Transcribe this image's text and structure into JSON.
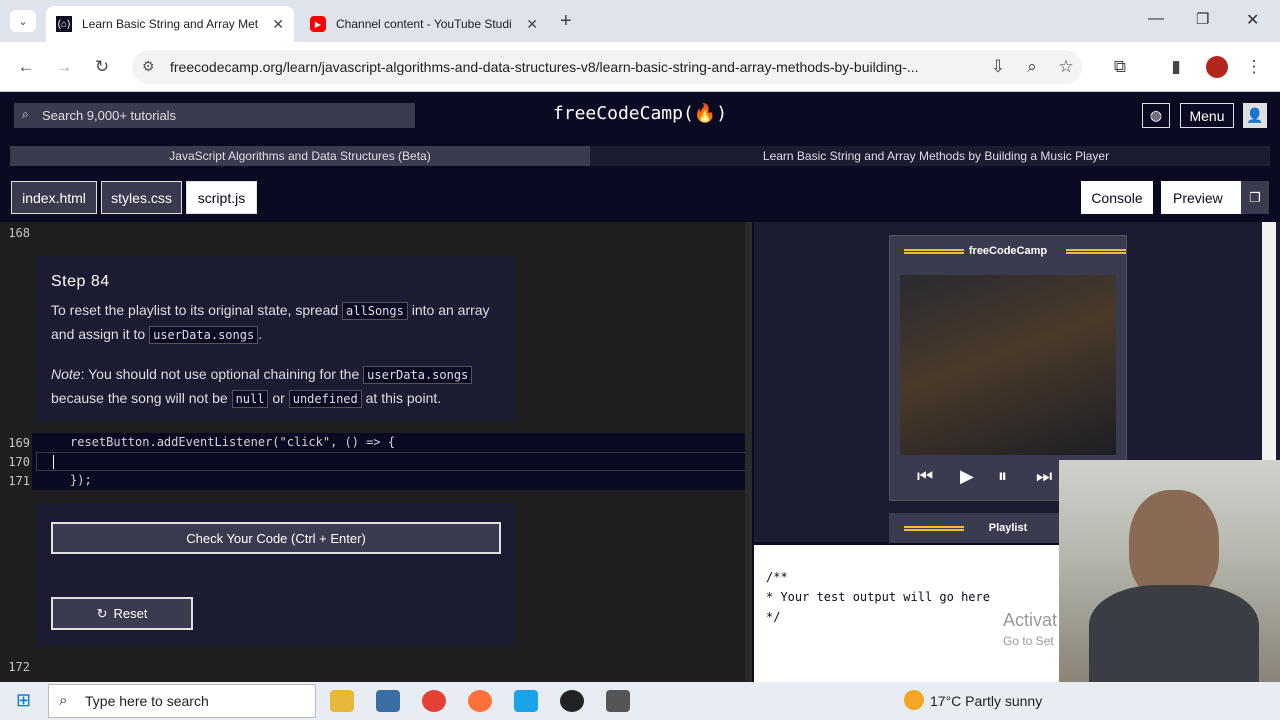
{
  "browser": {
    "tabs": [
      {
        "title": "Learn Basic String and Array Met",
        "active": true
      },
      {
        "title": "Channel content - YouTube Studi",
        "active": false
      }
    ],
    "url": "freecodecamp.org/learn/javascript-algorithms-and-data-structures-v8/learn-basic-string-and-array-methods-by-building-..."
  },
  "nav": {
    "search_placeholder": "Search 9,000+ tutorials",
    "logo": "freeCodeCamp(🔥)",
    "menu_label": "Menu"
  },
  "breadcrumb": {
    "course": "JavaScript Algorithms and Data Structures (Beta)",
    "project": "Learn Basic String and Array Methods by Building a Music Player"
  },
  "files": [
    "index.html",
    "styles.css",
    "script.js"
  ],
  "active_file": "script.js",
  "right_buttons": {
    "console": "Console",
    "preview": "Preview"
  },
  "editor": {
    "line_168": "168",
    "line_172": "172",
    "step": {
      "title": "Step 84",
      "p1_a": "To reset the playlist to its original state, spread",
      "p1_code1": "allSongs",
      "p1_b": "into an array and assign it to",
      "p1_code2": "userData.songs",
      "p1_c": ".",
      "note_label": "Note",
      "p2_a": ": You should not use optional chaining for the",
      "p2_code1": "userData.songs",
      "p2_b": "because the song will not be",
      "p2_code2": "null",
      "p2_c": "or",
      "p2_code3": "undefined",
      "p2_d": "at this point."
    },
    "code_lines": [
      {
        "n": "169",
        "text": "resetButton.addEventListener(\"click\", () => {"
      },
      {
        "n": "170",
        "text": ""
      },
      {
        "n": "171",
        "text": "});"
      }
    ],
    "check_button": "Check Your Code (Ctrl + Enter)",
    "reset_button": "Reset"
  },
  "preview": {
    "player_title": "freeCodeCamp",
    "playlist_title": "Playlist"
  },
  "console": {
    "lines": [
      "/**",
      "* Your test output will go here",
      "*/"
    ]
  },
  "watermark": {
    "line1": "Activat",
    "line2": "Go to Set"
  },
  "taskbar": {
    "search": "Type here to search",
    "weather": "17°C  Partly sunny"
  }
}
